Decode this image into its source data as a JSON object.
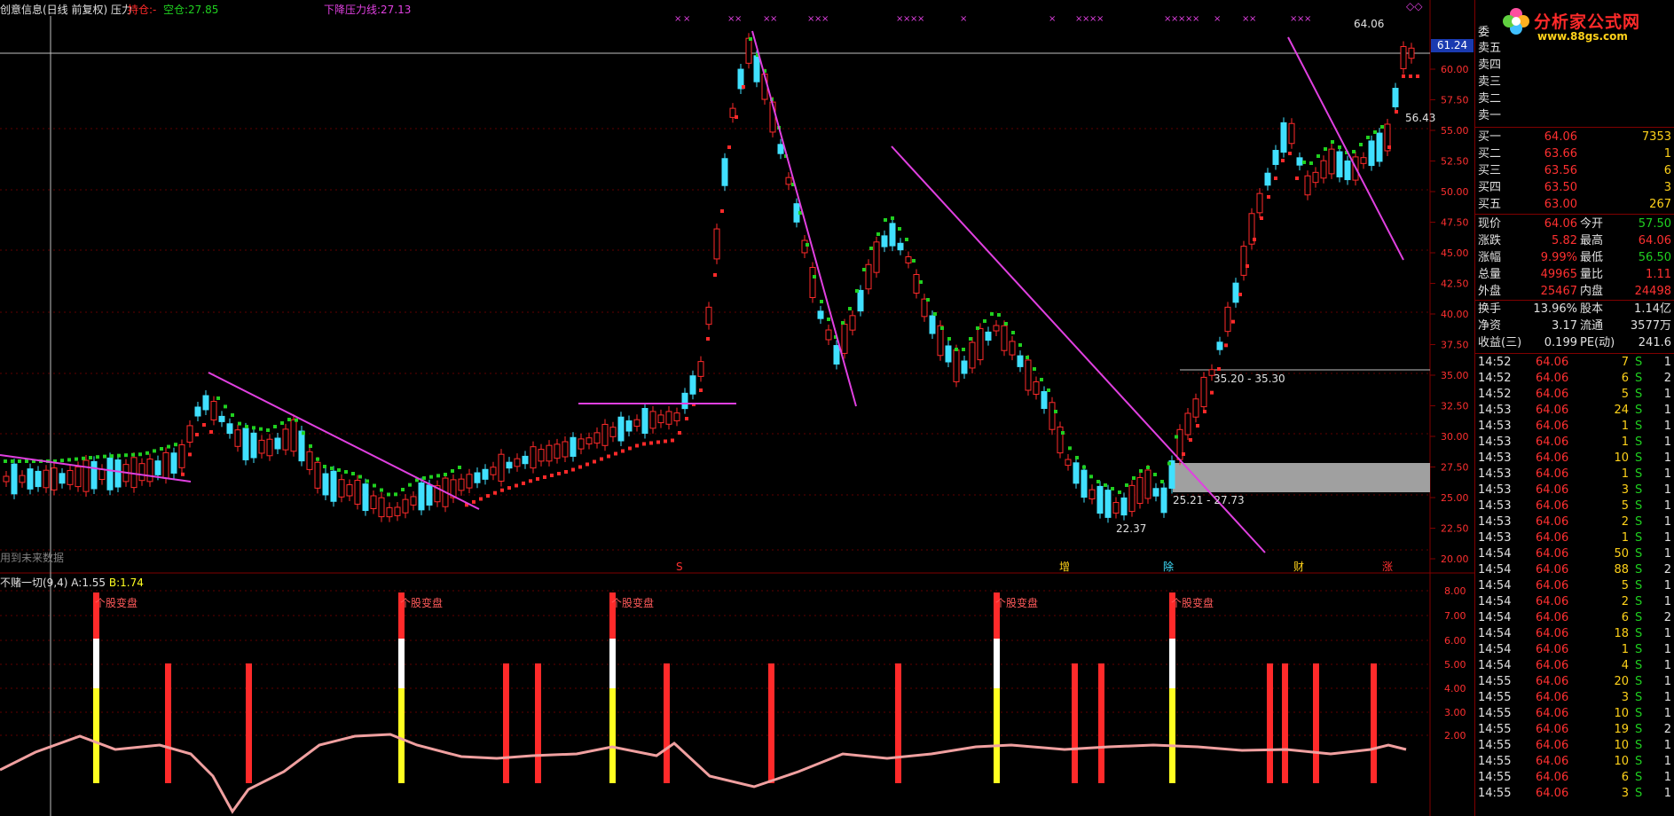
{
  "header": {
    "title": "创意信息(日线 前复权)",
    "indicator": "压力",
    "hold_label": "持仓:",
    "hold_value": "-",
    "empty_label": "空仓:",
    "empty_value": "27.85",
    "pressure_label": "下降压力线:",
    "pressure_value": "27.13",
    "no_future_data": "用到未来数据"
  },
  "price_axis": {
    "ticks": [
      "60.00",
      "57.50",
      "55.00",
      "52.50",
      "50.00",
      "47.50",
      "45.00",
      "42.50",
      "40.00",
      "37.50",
      "35.00",
      "32.50",
      "30.00",
      "27.50",
      "25.00",
      "22.50",
      "20.00"
    ],
    "current_price": "61.24"
  },
  "annotations": {
    "high_label": "64.06",
    "label_5643": "56.43",
    "low_label": "22.37",
    "zone1": "35.20 - 35.30",
    "zone2": "25.21 - 27.73",
    "signal_s": "S",
    "signal_zeng": "增",
    "signal_chu": "除",
    "signal_caicai": "财",
    "signal_zhang": "涨"
  },
  "indicator_panel": {
    "name": "不赌一切(9,4)",
    "a_label": "A:",
    "a_value": "1.55",
    "b_label": "B:",
    "b_value": "1.74",
    "ticks": [
      "8.00",
      "7.00",
      "6.00",
      "5.00",
      "4.00",
      "3.00",
      "2.00"
    ],
    "event_label": "个股变盘",
    "event_count": 5
  },
  "quote": {
    "wei_label": "委",
    "sell": [
      {
        "label": "卖五",
        "price": "",
        "vol": ""
      },
      {
        "label": "卖四",
        "price": "",
        "vol": ""
      },
      {
        "label": "卖三",
        "price": "",
        "vol": ""
      },
      {
        "label": "卖二",
        "price": "",
        "vol": ""
      },
      {
        "label": "卖一",
        "price": "",
        "vol": ""
      }
    ],
    "buy": [
      {
        "label": "买一",
        "price": "64.06",
        "vol": "7353"
      },
      {
        "label": "买二",
        "price": "63.66",
        "vol": "1"
      },
      {
        "label": "买三",
        "price": "63.56",
        "vol": "6"
      },
      {
        "label": "买四",
        "price": "63.50",
        "vol": "3"
      },
      {
        "label": "买五",
        "price": "63.00",
        "vol": "267"
      }
    ],
    "stats": [
      {
        "l1": "现价",
        "v1": "64.06",
        "l2": "今开",
        "v2": "57.50"
      },
      {
        "l1": "涨跌",
        "v1": "5.82",
        "l2": "最高",
        "v2": "64.06"
      },
      {
        "l1": "涨幅",
        "v1": "9.99%",
        "l2": "最低",
        "v2": "56.50"
      },
      {
        "l1": "总量",
        "v1": "49965",
        "l2": "量比",
        "v2": "1.11"
      },
      {
        "l1": "外盘",
        "v1": "25467",
        "l2": "内盘",
        "v2": "24498"
      }
    ],
    "stats2": [
      {
        "l1": "换手",
        "v1": "13.96%",
        "l2": "股本",
        "v2": "1.14亿"
      },
      {
        "l1": "净资",
        "v1": "3.17",
        "l2": "流通",
        "v2": "3577万"
      },
      {
        "l1": "收益(三)",
        "v1": "0.199",
        "l2": "PE(动)",
        "v2": "241.6"
      }
    ],
    "ticks": [
      {
        "t": "14:52",
        "p": "64.06",
        "v": "7",
        "s": "S",
        "n": "1"
      },
      {
        "t": "14:52",
        "p": "64.06",
        "v": "6",
        "s": "S",
        "n": "2"
      },
      {
        "t": "14:52",
        "p": "64.06",
        "v": "5",
        "s": "S",
        "n": "1"
      },
      {
        "t": "14:53",
        "p": "64.06",
        "v": "24",
        "s": "S",
        "n": "1"
      },
      {
        "t": "14:53",
        "p": "64.06",
        "v": "1",
        "s": "S",
        "n": "1"
      },
      {
        "t": "14:53",
        "p": "64.06",
        "v": "1",
        "s": "S",
        "n": "1"
      },
      {
        "t": "14:53",
        "p": "64.06",
        "v": "10",
        "s": "S",
        "n": "1"
      },
      {
        "t": "14:53",
        "p": "64.06",
        "v": "1",
        "s": "S",
        "n": "1"
      },
      {
        "t": "14:53",
        "p": "64.06",
        "v": "3",
        "s": "S",
        "n": "1"
      },
      {
        "t": "14:53",
        "p": "64.06",
        "v": "5",
        "s": "S",
        "n": "1"
      },
      {
        "t": "14:53",
        "p": "64.06",
        "v": "2",
        "s": "S",
        "n": "1"
      },
      {
        "t": "14:53",
        "p": "64.06",
        "v": "1",
        "s": "S",
        "n": "1"
      },
      {
        "t": "14:54",
        "p": "64.06",
        "v": "50",
        "s": "S",
        "n": "1"
      },
      {
        "t": "14:54",
        "p": "64.06",
        "v": "88",
        "s": "S",
        "n": "2"
      },
      {
        "t": "14:54",
        "p": "64.06",
        "v": "5",
        "s": "S",
        "n": "1"
      },
      {
        "t": "14:54",
        "p": "64.06",
        "v": "2",
        "s": "S",
        "n": "1"
      },
      {
        "t": "14:54",
        "p": "64.06",
        "v": "6",
        "s": "S",
        "n": "2"
      },
      {
        "t": "14:54",
        "p": "64.06",
        "v": "18",
        "s": "S",
        "n": "1"
      },
      {
        "t": "14:54",
        "p": "64.06",
        "v": "1",
        "s": "S",
        "n": "1"
      },
      {
        "t": "14:54",
        "p": "64.06",
        "v": "4",
        "s": "S",
        "n": "1"
      },
      {
        "t": "14:55",
        "p": "64.06",
        "v": "20",
        "s": "S",
        "n": "1"
      },
      {
        "t": "14:55",
        "p": "64.06",
        "v": "3",
        "s": "S",
        "n": "1"
      },
      {
        "t": "14:55",
        "p": "64.06",
        "v": "10",
        "s": "S",
        "n": "1"
      },
      {
        "t": "14:55",
        "p": "64.06",
        "v": "19",
        "s": "S",
        "n": "2"
      },
      {
        "t": "14:55",
        "p": "64.06",
        "v": "10",
        "s": "S",
        "n": "1"
      },
      {
        "t": "14:55",
        "p": "64.06",
        "v": "10",
        "s": "S",
        "n": "1"
      },
      {
        "t": "14:55",
        "p": "64.06",
        "v": "6",
        "s": "S",
        "n": "1"
      },
      {
        "t": "14:55",
        "p": "64.06",
        "v": "3",
        "s": "S",
        "n": "1"
      }
    ]
  },
  "logo": {
    "text": "分析家公式网",
    "url": "www.88gs.com"
  },
  "colors": {
    "up": "#ff2a2a",
    "down": "#40e0ff",
    "green": "#20d020",
    "magenta": "#e040e0",
    "yellow": "#ffff20",
    "axis": "#800000"
  }
}
